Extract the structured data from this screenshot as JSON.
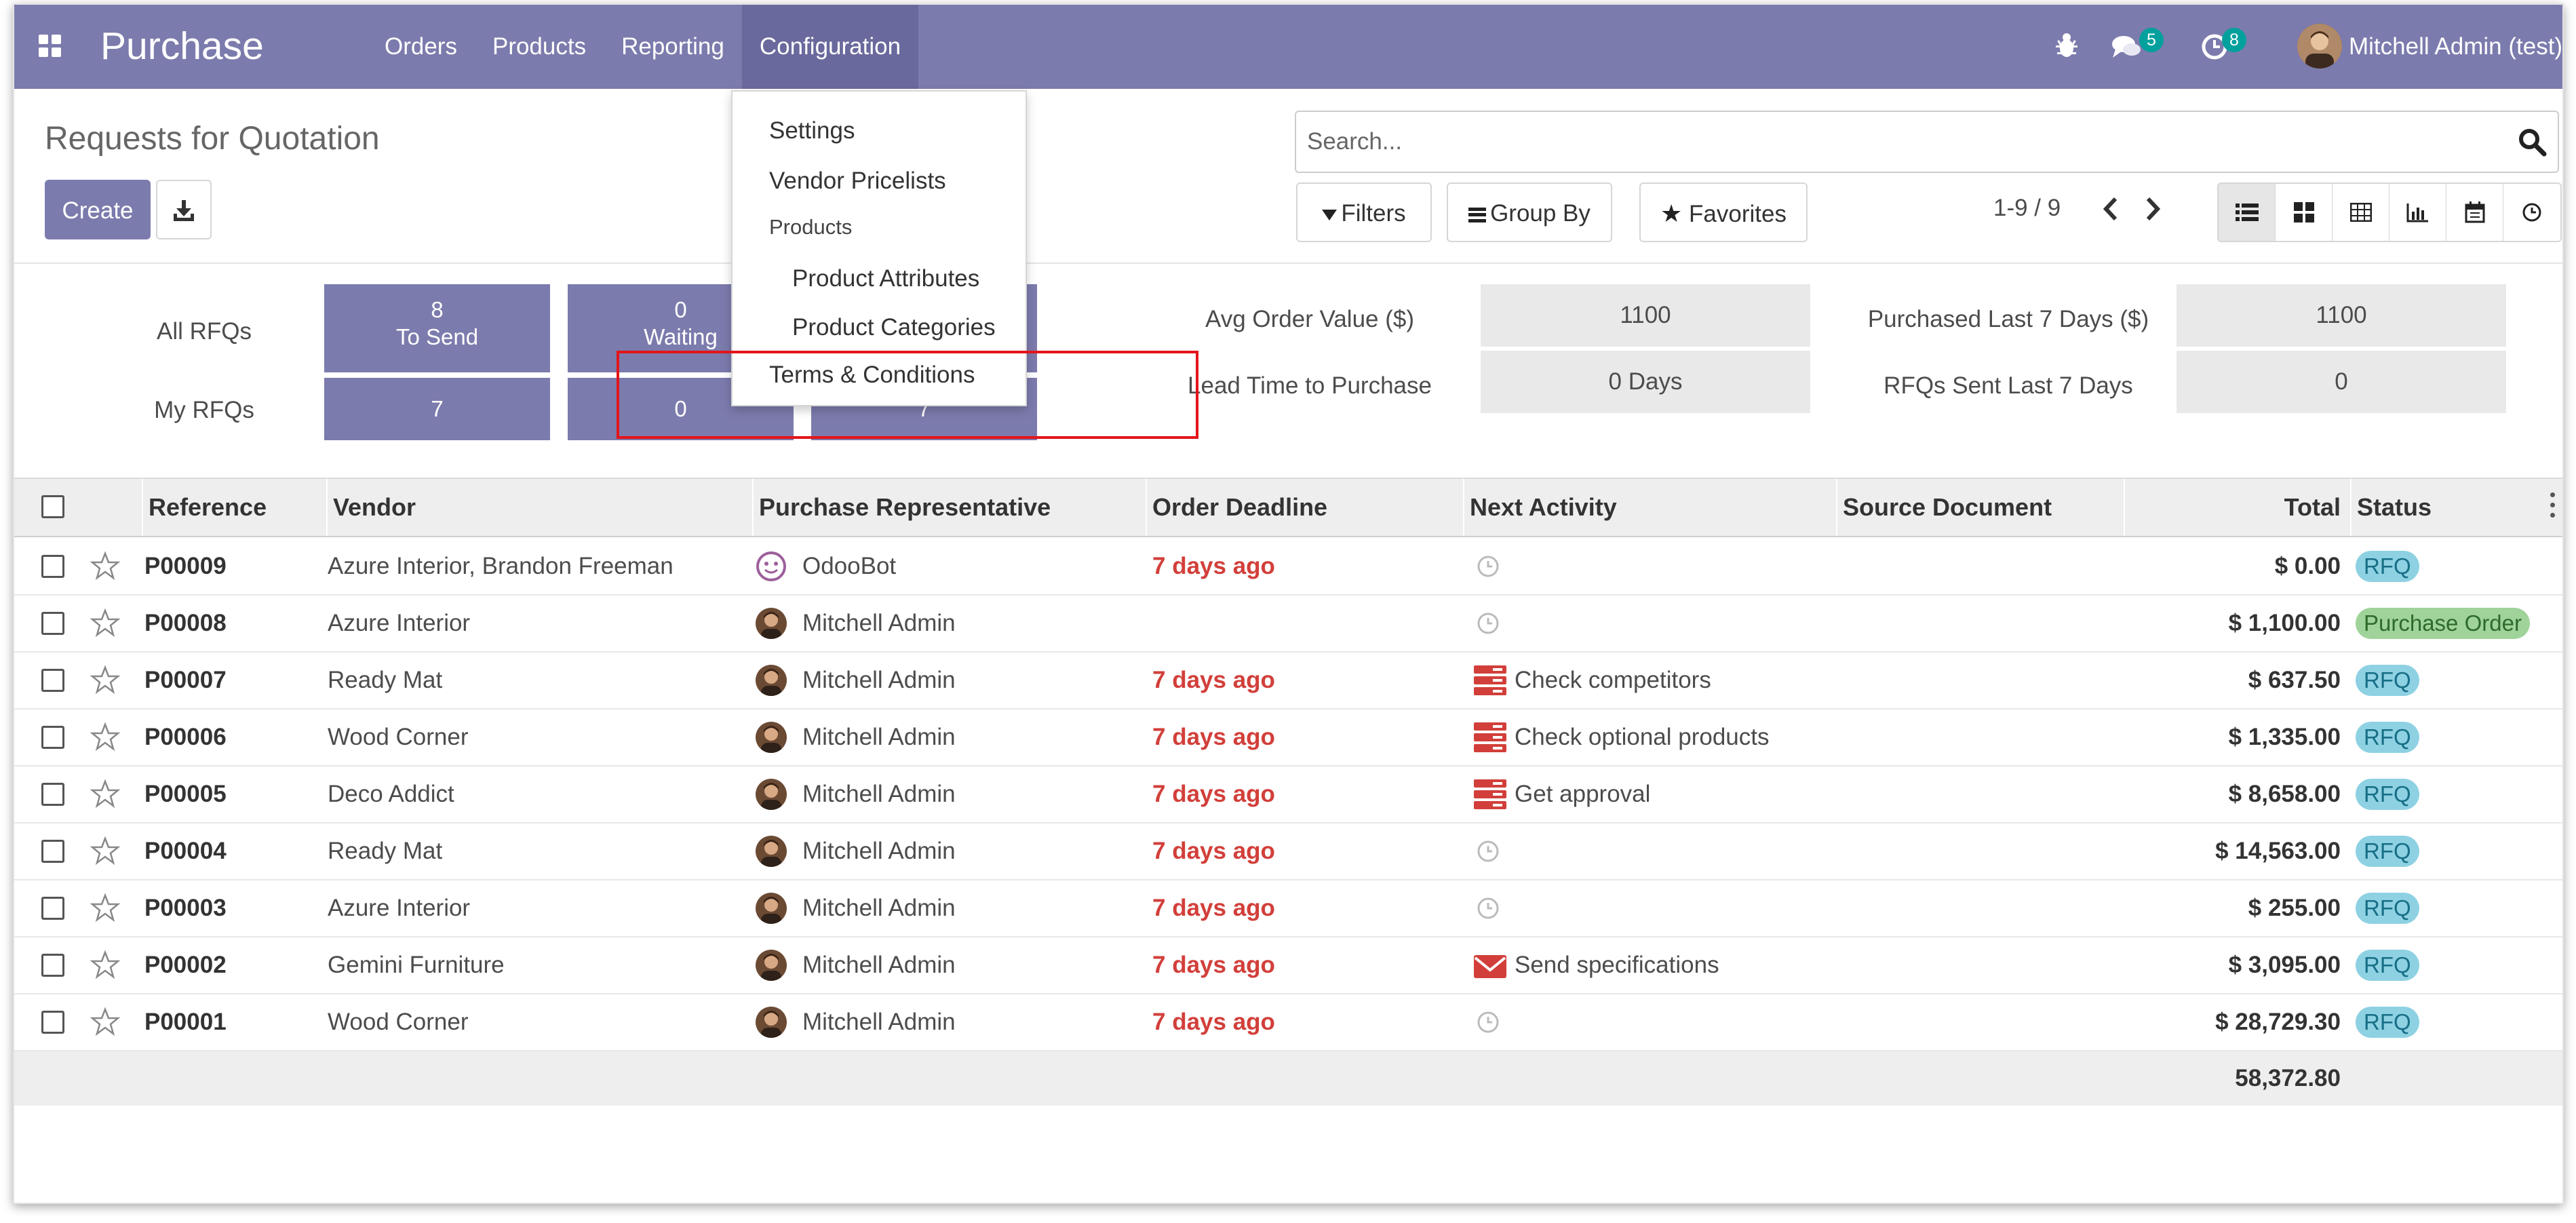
{
  "navbar": {
    "brand": "Purchase",
    "menu": [
      "Orders",
      "Products",
      "Reporting",
      "Configuration"
    ],
    "active_menu": "Configuration",
    "messages_count": "5",
    "activities_count": "8",
    "user_name": "Mitchell Admin (test)",
    "accent_color": "#7c7bad"
  },
  "control_panel": {
    "breadcrumb": "Requests for Quotation",
    "create_label": "Create",
    "search_placeholder": "Search...",
    "filters_label": "Filters",
    "group_by_label": "Group By",
    "favorites_label": "Favorites",
    "pager_value": "1-9 / 9",
    "views": [
      "list-icon",
      "kanban-icon",
      "pivot-icon",
      "graph-icon",
      "calendar-icon",
      "activity-icon"
    ]
  },
  "dropdown": {
    "items": [
      "Settings",
      "Vendor Pricelists"
    ],
    "section_header": "Products",
    "sub_items": [
      "Product Attributes",
      "Product Categories"
    ],
    "highlighted_item": "Terms & Conditions"
  },
  "dashboard": {
    "all_rfqs_label": "All RFQs",
    "my_rfqs_label": "My RFQs",
    "to_send_count": "8",
    "to_send_label": "To Send",
    "waiting_count": "0",
    "waiting_label": "Waiting",
    "my_to_send": "7",
    "my_waiting": "0",
    "my_late": "7",
    "kpis": [
      {
        "label": "Avg Order Value ($)",
        "value": "1100"
      },
      {
        "label": "Lead Time to Purchase",
        "value": "0  Days"
      },
      {
        "label": "Purchased Last 7 Days ($)",
        "value": "1100"
      },
      {
        "label": "RFQs Sent Last 7 Days",
        "value": "0"
      }
    ]
  },
  "table": {
    "columns": [
      "Reference",
      "Vendor",
      "Purchase Representative",
      "Order Deadline",
      "Next Activity",
      "Source Document",
      "Total",
      "Status"
    ],
    "rows": [
      {
        "ref": "P00009",
        "vendor": "Azure Interior, Brandon Freeman",
        "rep": "OdooBot",
        "deadline": "7 days ago",
        "activity": "",
        "activity_icon": "clock-icon",
        "total": "$ 0.00",
        "status": "RFQ"
      },
      {
        "ref": "P00008",
        "vendor": "Azure Interior",
        "rep": "Mitchell Admin",
        "deadline": "",
        "activity": "",
        "activity_icon": "clock-icon",
        "total": "$ 1,100.00",
        "status": "Purchase Order"
      },
      {
        "ref": "P00007",
        "vendor": "Ready Mat",
        "rep": "Mitchell Admin",
        "deadline": "7 days ago",
        "activity": "Check competitors",
        "activity_icon": "server-icon",
        "total": "$ 637.50",
        "status": "RFQ"
      },
      {
        "ref": "P00006",
        "vendor": "Wood Corner",
        "rep": "Mitchell Admin",
        "deadline": "7 days ago",
        "activity": "Check optional products",
        "activity_icon": "server-icon",
        "total": "$ 1,335.00",
        "status": "RFQ"
      },
      {
        "ref": "P00005",
        "vendor": "Deco Addict",
        "rep": "Mitchell Admin",
        "deadline": "7 days ago",
        "activity": "Get approval",
        "activity_icon": "server-icon",
        "total": "$ 8,658.00",
        "status": "RFQ"
      },
      {
        "ref": "P00004",
        "vendor": "Ready Mat",
        "rep": "Mitchell Admin",
        "deadline": "7 days ago",
        "activity": "",
        "activity_icon": "clock-icon",
        "total": "$ 14,563.00",
        "status": "RFQ"
      },
      {
        "ref": "P00003",
        "vendor": "Azure Interior",
        "rep": "Mitchell Admin",
        "deadline": "7 days ago",
        "activity": "",
        "activity_icon": "clock-icon",
        "total": "$ 255.00",
        "status": "RFQ"
      },
      {
        "ref": "P00002",
        "vendor": "Gemini Furniture",
        "rep": "Mitchell Admin",
        "deadline": "7 days ago",
        "activity": "Send specifications",
        "activity_icon": "envelope-icon",
        "total": "$ 3,095.00",
        "status": "RFQ"
      },
      {
        "ref": "P00001",
        "vendor": "Wood Corner",
        "rep": "Mitchell Admin",
        "deadline": "7 days ago",
        "activity": "",
        "activity_icon": "clock-icon",
        "total": "$ 28,729.30",
        "status": "RFQ"
      }
    ],
    "grand_total": "58,372.80"
  }
}
